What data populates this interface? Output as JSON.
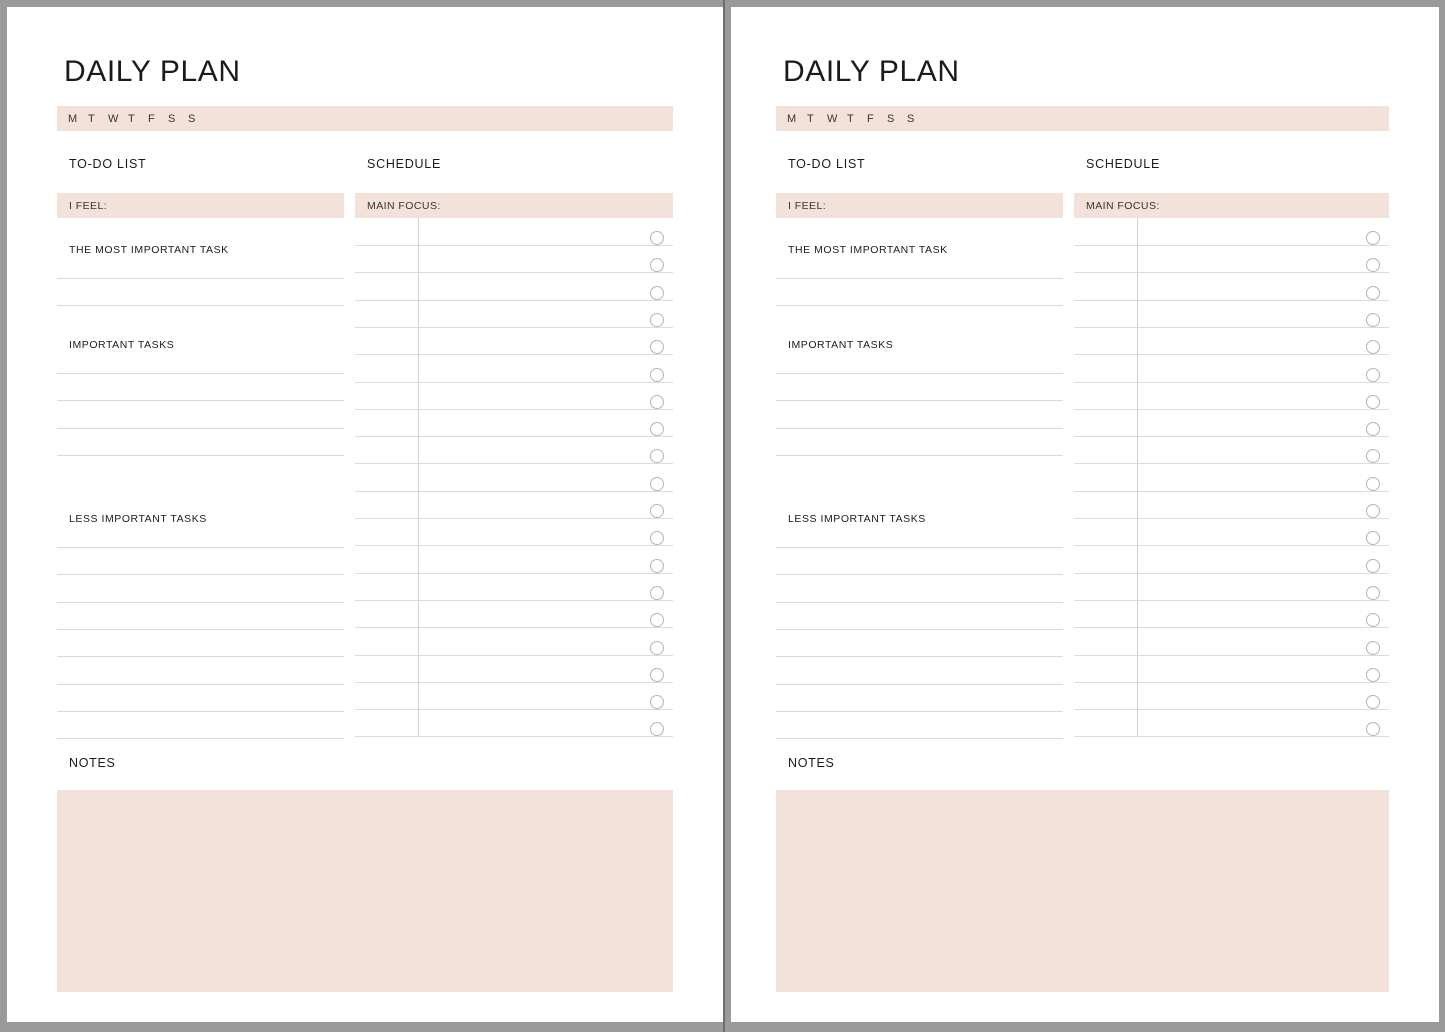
{
  "meta": {
    "background_color": "#9a9a9a",
    "page_color": "#ffffff",
    "accent_pink": "#f3e2da",
    "rule_color": "#d8d8d8",
    "text_color": "#1b1b1b"
  },
  "page": {
    "title": "DAILY PLAN",
    "days": [
      "M",
      "T",
      "W",
      "T",
      "F",
      "S",
      "S"
    ],
    "todo": {
      "heading": "TO-DO LIST",
      "feel_label": "I FEEL:",
      "sections": [
        {
          "label": "THE MOST IMPORTANT TASK",
          "lines": 2
        },
        {
          "label": "IMPORTANT TASKS",
          "lines": 4
        },
        {
          "label": "LESS IMPORTANT TASKS",
          "lines": 8
        }
      ]
    },
    "schedule": {
      "heading": "SCHEDULE",
      "main_focus_label": "MAIN FOCUS:",
      "rows": 19
    },
    "notes": {
      "label": "NOTES"
    }
  },
  "pages": [
    {
      "id": "left-page"
    },
    {
      "id": "right-page"
    }
  ]
}
